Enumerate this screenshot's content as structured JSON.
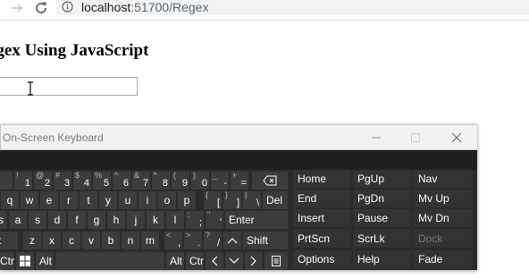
{
  "browser": {
    "url_host": "localhost",
    "url_rest": ":51700/Regex"
  },
  "page": {
    "title": "egex Using JavaScript",
    "input_value": ""
  },
  "osk": {
    "title": "On-Screen Keyboard",
    "row1": [
      {
        "sub": "",
        "main": ""
      },
      {
        "sub": "!",
        "main": "1"
      },
      {
        "sub": "@",
        "main": "2"
      },
      {
        "sub": "#",
        "main": "3"
      },
      {
        "sub": "$",
        "main": "4"
      },
      {
        "sub": "%",
        "main": "5"
      },
      {
        "sub": "^",
        "main": "6"
      },
      {
        "sub": "&",
        "main": "7"
      },
      {
        "sub": "*",
        "main": "8"
      },
      {
        "sub": "(",
        "main": "9"
      },
      {
        "sub": ")",
        "main": "0"
      },
      {
        "sub": "_",
        "main": "-"
      },
      {
        "sub": "+",
        "main": "="
      }
    ],
    "row2_letters": [
      "q",
      "w",
      "e",
      "r",
      "t",
      "y",
      "u",
      "i",
      "o",
      "p"
    ],
    "row2_sym": [
      {
        "sub": "{",
        "main": "["
      },
      {
        "sub": "}",
        "main": "]"
      },
      {
        "sub": "|",
        "main": "\\"
      }
    ],
    "del": "Del",
    "row3_left": "s",
    "row3_letters": [
      "a",
      "s",
      "d",
      "f",
      "g",
      "h",
      "j",
      "k",
      "l"
    ],
    "row3_sym": [
      {
        "sub": ":",
        "main": ";"
      },
      {
        "sub": "\"",
        "main": "'"
      }
    ],
    "enter": "Enter",
    "row4_left": "t",
    "row4_letters": [
      "z",
      "x",
      "c",
      "v",
      "b",
      "n",
      "m"
    ],
    "row4_sym": [
      {
        "sub": "<",
        "main": ","
      },
      {
        "sub": ">",
        "main": "."
      },
      {
        "sub": "?",
        "main": "/"
      }
    ],
    "shift": "Shift",
    "ctrl_left": "Ctr",
    "alt_left": "Alt",
    "alt_right": "Alt",
    "ctrl_right": "Ctr",
    "right_col1": [
      "Home",
      "End",
      "Insert",
      "PrtScn",
      "Options"
    ],
    "right_col2": [
      "PgUp",
      "PgDn",
      "Pause",
      "ScrLk",
      "Help"
    ],
    "right_col3": [
      "Nav",
      "Mv Up",
      "Mv Dn",
      "Dock",
      "Fade"
    ]
  },
  "icons": {
    "back": "back-arrow-icon",
    "forward": "forward-arrow-icon",
    "reload": "reload-icon",
    "info": "info-icon",
    "backspace": "backspace-icon",
    "windows": "windows-logo-icon"
  }
}
